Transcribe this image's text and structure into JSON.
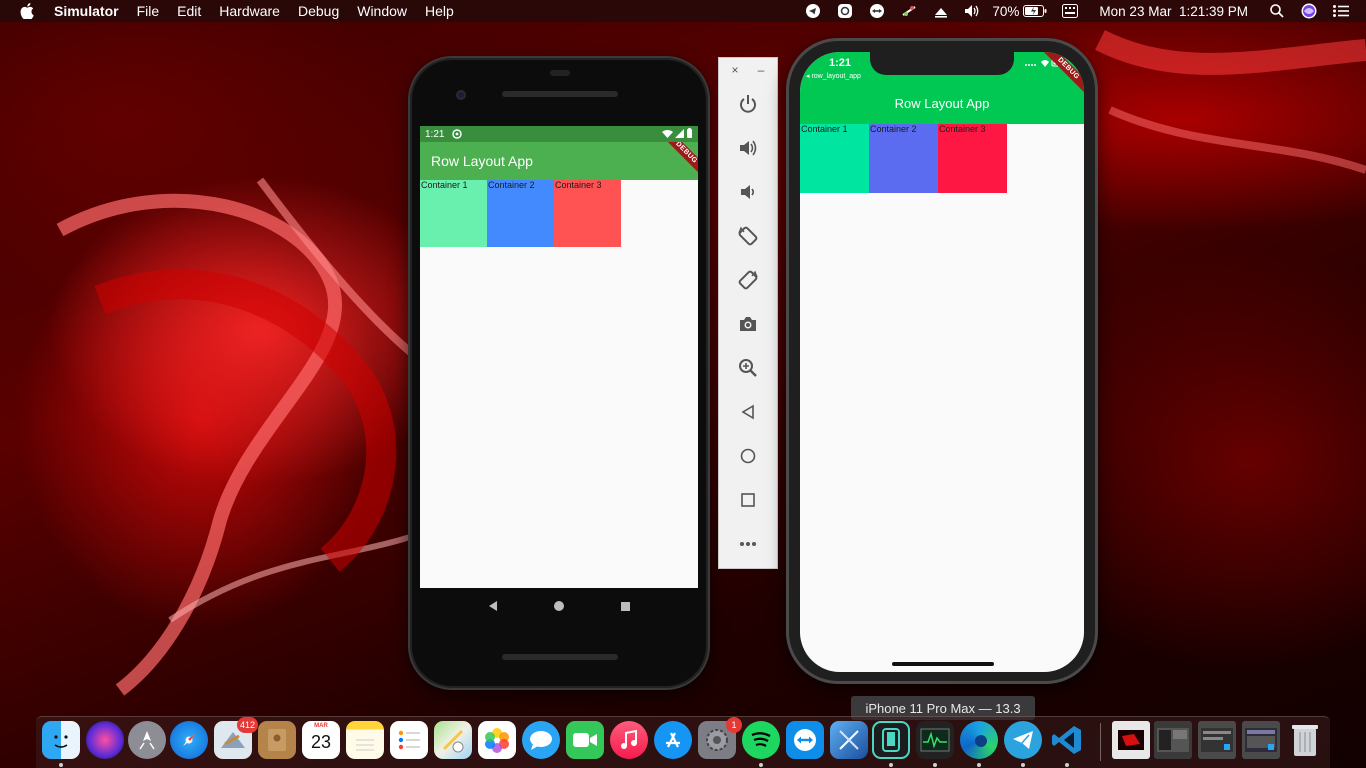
{
  "menubar": {
    "app_name": "Simulator",
    "items": [
      "File",
      "Edit",
      "Hardware",
      "Debug",
      "Window",
      "Help"
    ],
    "battery": "70%",
    "clock": "Mon 23 Mar  1:21:39 PM"
  },
  "android": {
    "status_time": "1:21",
    "app_title": "Row Layout App",
    "debug_banner": "DEBUG",
    "containers": [
      {
        "label": "Container 1",
        "color": "#69f0ae"
      },
      {
        "label": "Container 2",
        "color": "#448aff"
      },
      {
        "label": "Container 3",
        "color": "#ff5252"
      }
    ]
  },
  "emulator_toolbar": {
    "close": "×",
    "minimize": "–",
    "tools": [
      "power-icon",
      "volume-up-icon",
      "volume-down-icon",
      "rotate-left-icon",
      "rotate-right-icon",
      "camera-icon",
      "zoom-icon",
      "back-icon",
      "home-icon",
      "overview-icon",
      "more-icon"
    ]
  },
  "iphone": {
    "status_time": "1:21",
    "back_label": "◂ row_layout_app",
    "app_title": "Row Layout App",
    "debug_banner": "DEBUG",
    "containers": [
      {
        "label": "Container 1",
        "color": "#00e6a0"
      },
      {
        "label": "Container 2",
        "color": "#5c6cf0"
      },
      {
        "label": "Container 3",
        "color": "#ff1744"
      }
    ]
  },
  "tooltip": "iPhone 11 Pro Max — 13.3",
  "dock": {
    "mail_badge": "412",
    "calendar_month": "MAR",
    "calendar_day": "23",
    "prefs_badge": "1"
  }
}
